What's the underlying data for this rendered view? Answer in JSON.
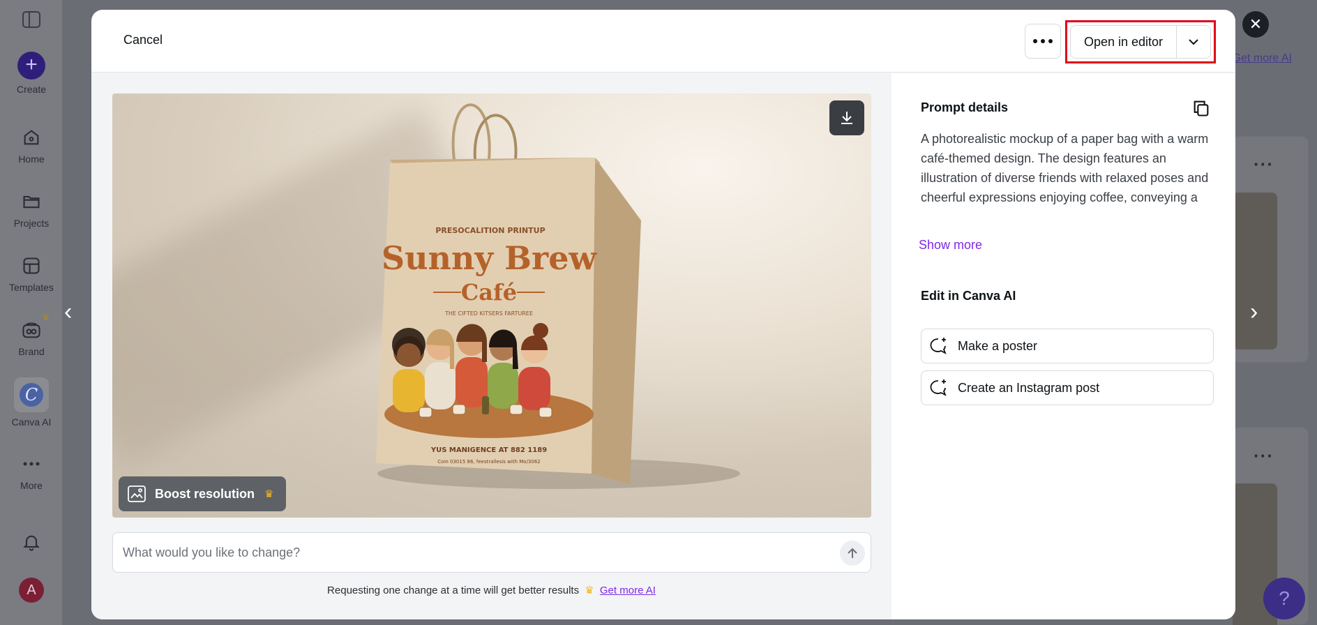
{
  "sidebar": {
    "create": "Create",
    "home": "Home",
    "projects": "Projects",
    "templates": "Templates",
    "brand": "Brand",
    "canva_ai": "Canva AI",
    "more": "More",
    "avatar_initial": "A"
  },
  "background": {
    "link": "Get more AI"
  },
  "modal": {
    "cancel": "Cancel",
    "open_in_editor": "Open in editor",
    "boost_resolution": "Boost resolution",
    "input_placeholder": "What would you like to change?",
    "hint_text": "Requesting one change at a time will get better results",
    "hint_link": "Get more AI",
    "prompt_title": "Prompt details",
    "prompt_text": "A photorealistic mockup of a paper bag with a warm café-themed design. The design features an illustration of diverse friends with relaxed poses and cheerful expressions enjoying coffee, conveying a sense of connection. The café name…",
    "show_more": "Show more",
    "edit_title": "Edit in Canva AI",
    "edit_options": [
      "Make a poster",
      "Create an Instagram post"
    ]
  },
  "bag": {
    "top_arc": "PRESOCALITION PRINTUP",
    "brand_line1": "Sunny Brew",
    "brand_line2": "Café",
    "tagline": "THE CIFTED KITSERS FARTUREE",
    "bottom1": "YUS MANIGENCE AT 882 1189",
    "bottom2": "Coin 03015 86, feestrallesis with Mo/3062"
  },
  "colors": {
    "accent": "#7d2ae8",
    "highlight": "#e0001b",
    "crown": "#f2b726"
  }
}
